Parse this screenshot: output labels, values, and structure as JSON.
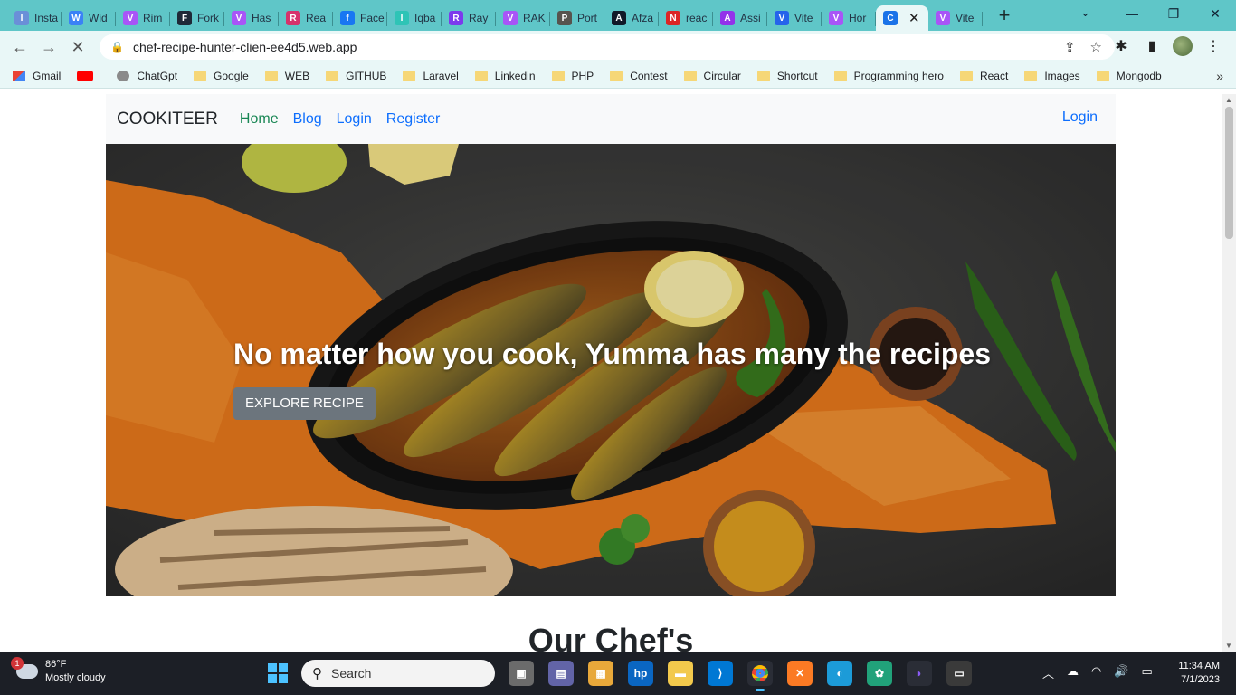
{
  "browser": {
    "tabs": [
      {
        "label": "Insta",
        "color": "#6a8fd8",
        "glyph": "I"
      },
      {
        "label": "Wid",
        "color": "#3b82f6",
        "glyph": "W"
      },
      {
        "label": "Rim",
        "color": "#a855f7",
        "glyph": "V"
      },
      {
        "label": "Fork",
        "color": "#1f2937",
        "glyph": "F"
      },
      {
        "label": "Has",
        "color": "#a855f7",
        "glyph": "V"
      },
      {
        "label": "Rea",
        "color": "#d6336c",
        "glyph": "R"
      },
      {
        "label": "Face",
        "color": "#1877f2",
        "glyph": "f"
      },
      {
        "label": "Iqba",
        "color": "#2ec4b6",
        "glyph": "I"
      },
      {
        "label": "Ray",
        "color": "#7c3aed",
        "glyph": "R"
      },
      {
        "label": "RAK",
        "color": "#a855f7",
        "glyph": "V"
      },
      {
        "label": "Port",
        "color": "#57534e",
        "glyph": "P"
      },
      {
        "label": "Afza",
        "color": "#111827",
        "glyph": "A"
      },
      {
        "label": "reac",
        "color": "#dc2626",
        "glyph": "N"
      },
      {
        "label": "Assi",
        "color": "#9333ea",
        "glyph": "A"
      },
      {
        "label": "Vite",
        "color": "#2563eb",
        "glyph": "V"
      },
      {
        "label": "Hor",
        "color": "#a855f7",
        "glyph": "V"
      },
      {
        "label": "",
        "color": "#1a73e8",
        "glyph": "C",
        "active": true
      },
      {
        "label": "Vite",
        "color": "#a855f7",
        "glyph": "V"
      }
    ],
    "new_tab": "+",
    "url": "chef-recipe-hunter-clien-ee4d5.web.app",
    "bookmarks": [
      {
        "label": "Gmail",
        "type": "gmail"
      },
      {
        "label": "",
        "type": "youtube"
      },
      {
        "label": "ChatGpt",
        "type": "chatgpt"
      },
      {
        "label": "Google",
        "type": "folder"
      },
      {
        "label": "WEB",
        "type": "folder"
      },
      {
        "label": "GITHUB",
        "type": "folder"
      },
      {
        "label": "Laravel",
        "type": "folder"
      },
      {
        "label": "Linkedin",
        "type": "folder"
      },
      {
        "label": "PHP",
        "type": "folder"
      },
      {
        "label": "Contest",
        "type": "folder"
      },
      {
        "label": "Circular",
        "type": "folder"
      },
      {
        "label": "Shortcut",
        "type": "folder"
      },
      {
        "label": "Programming hero",
        "type": "folder"
      },
      {
        "label": "React",
        "type": "folder"
      },
      {
        "label": "Images",
        "type": "folder"
      },
      {
        "label": "Mongodb",
        "type": "folder"
      }
    ],
    "more_bookmarks": "»"
  },
  "site": {
    "brand": "COOKITEER",
    "nav": {
      "home": "Home",
      "blog": "Blog",
      "login": "Login",
      "register": "Register",
      "login_right": "Login"
    },
    "hero": {
      "title": "No matter how you cook, Yumma has many the recipes",
      "button": "EXPLORE RECIPE"
    },
    "section_title": "Our Chef's"
  },
  "taskbar": {
    "weather_temp": "86°F",
    "weather_desc": "Mostly cloudy",
    "weather_badge": "1",
    "search_placeholder": "Search",
    "time": "11:34 AM",
    "date": "7/1/2023"
  }
}
